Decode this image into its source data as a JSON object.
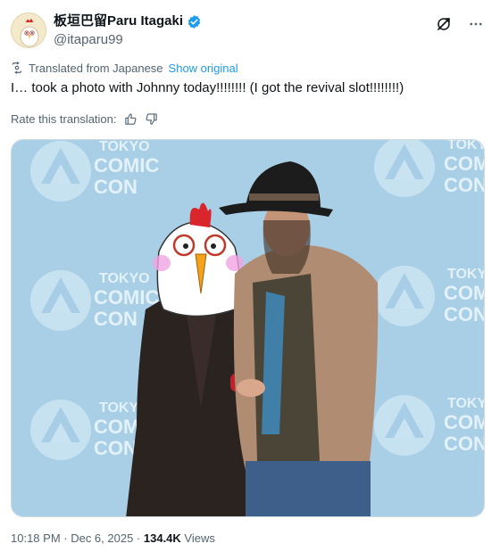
{
  "author": {
    "display_name": "板垣巴留Paru Itagaki",
    "handle": "@itaparu99",
    "verified_icon": "verified-badge-icon",
    "avatar_icon": "rooster-avatar-icon"
  },
  "header_actions": {
    "grok_icon": "grok-icon",
    "more_icon": "more-options-icon"
  },
  "translation": {
    "label": "Translated from Japanese",
    "show_original": "Show original"
  },
  "tweet_text": "I… took a photo with Johnny today!!!!!!!! (I got the revival slot!!!!!!!!)",
  "rate": {
    "label": "Rate this translation:"
  },
  "media": {
    "backdrop_logo_lines": [
      "TOKYO",
      "COMIC",
      "CON"
    ]
  },
  "meta": {
    "time_date": "10:18 PM · Dec 6, 2025 ·",
    "views_count": "134.4K",
    "views_label": "Views"
  },
  "colors": {
    "accent": "#1d9bf0",
    "text_primary": "#0f1419",
    "text_secondary": "#536471",
    "backdrop": "#a8cfe6"
  }
}
